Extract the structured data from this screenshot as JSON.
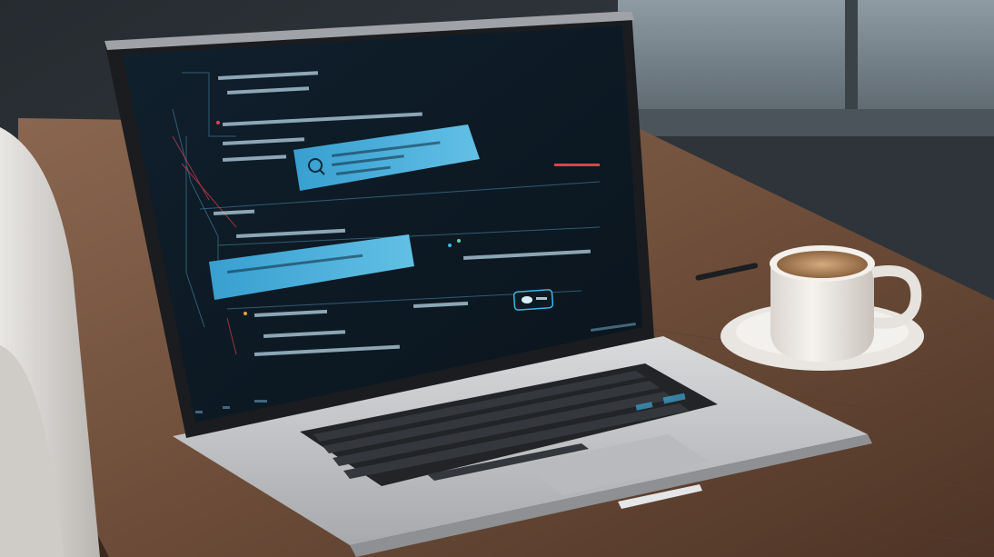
{
  "scene": {
    "description_level": "photo",
    "objects": [
      "laptop",
      "coffee-cup",
      "saucer",
      "pen",
      "wooden-desk",
      "chair",
      "window"
    ]
  },
  "laptop_screen": {
    "theme": "dark",
    "accent_color": "#3fb4e6",
    "background_color": "#0f1b26",
    "alert_color": "#e0424a",
    "chat_bubbles": [
      {
        "style": "highlighted",
        "icon": "chat-bubble-icon"
      },
      {
        "style": "highlighted",
        "icon": ""
      }
    ],
    "toggle_button": {
      "icon": "cloud-icon"
    }
  },
  "colors": {
    "desk": "#6e4e3a",
    "desk_dark": "#4a3226",
    "wall": "#3b4349",
    "window": "#7c8a93",
    "cup": "#eeeae5",
    "coffee": "#b88a5e",
    "laptop_body": "#c9cbcd",
    "keyboard": "#2a2c2f"
  }
}
